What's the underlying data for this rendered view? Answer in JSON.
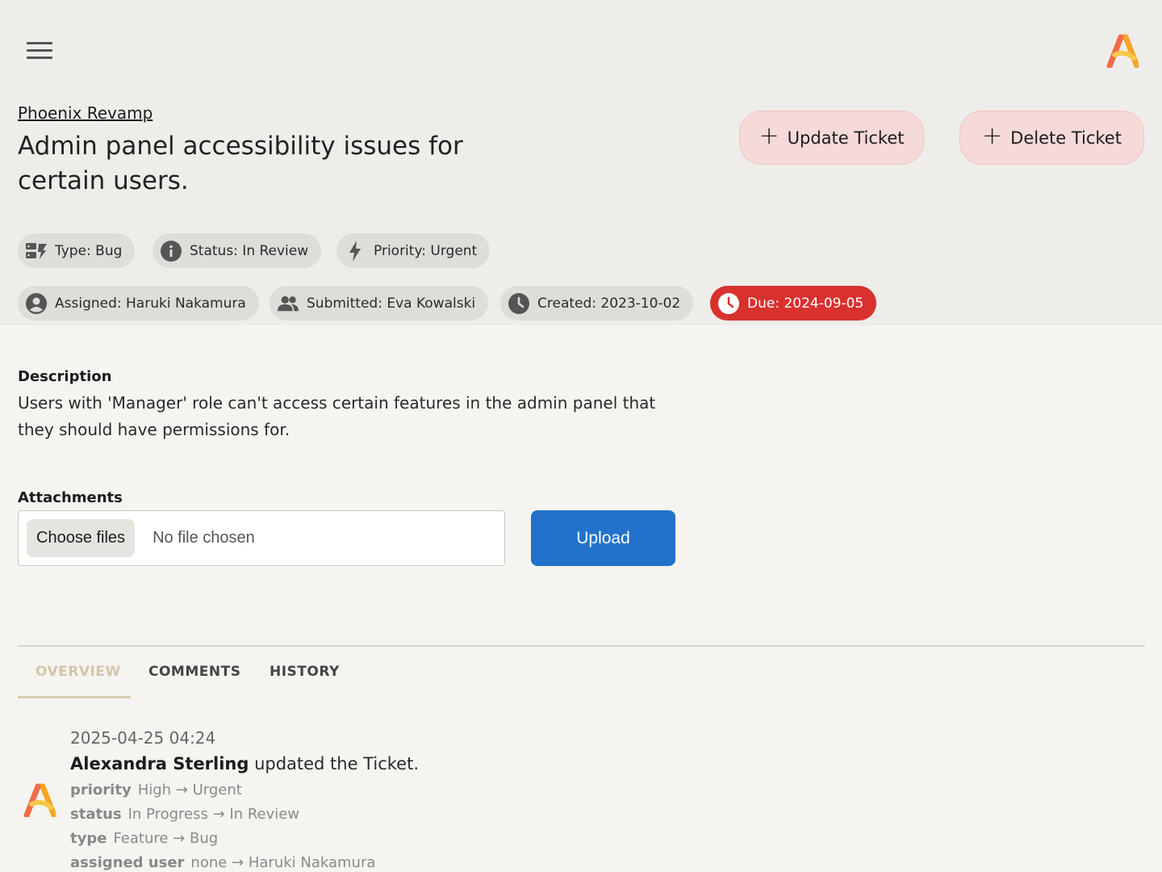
{
  "header": {
    "project": "Phoenix Revamp",
    "title": "Admin panel accessibility issues for certain users.",
    "update_label": "Update Ticket",
    "delete_label": "Delete Ticket"
  },
  "chips": {
    "type": "Type: Bug",
    "status": "Status: In Review",
    "priority": "Priority: Urgent",
    "assigned": "Assigned: Haruki Nakamura",
    "submitted": "Submitted: Eva Kowalski",
    "created": "Created: 2023-10-02",
    "due": "Due: 2024-09-05"
  },
  "description": {
    "label": "Description",
    "text": "Users with 'Manager' role can't access certain features in the admin panel that they should have permissions for."
  },
  "attachments": {
    "label": "Attachments",
    "choose_label": "Choose files",
    "no_file": "No file chosen",
    "upload_label": "Upload"
  },
  "tabs": [
    "OVERVIEW",
    "COMMENTS",
    "HISTORY"
  ],
  "history": {
    "timestamp": "2025-04-25 04:24",
    "user": "Alexandra Sterling",
    "action": "updated the Ticket.",
    "changes": [
      {
        "field": "priority",
        "change": "High → Urgent"
      },
      {
        "field": "status",
        "change": "In Progress → In Review"
      },
      {
        "field": "type",
        "change": "Feature → Bug"
      },
      {
        "field": "assigned user",
        "change": "none → Haruki Nakamura"
      }
    ]
  },
  "colors": {
    "accent_blue": "#2272cb",
    "due_red": "#d8312e",
    "action_pink": "#f6dada",
    "active_tab": "#d3c6a8"
  }
}
